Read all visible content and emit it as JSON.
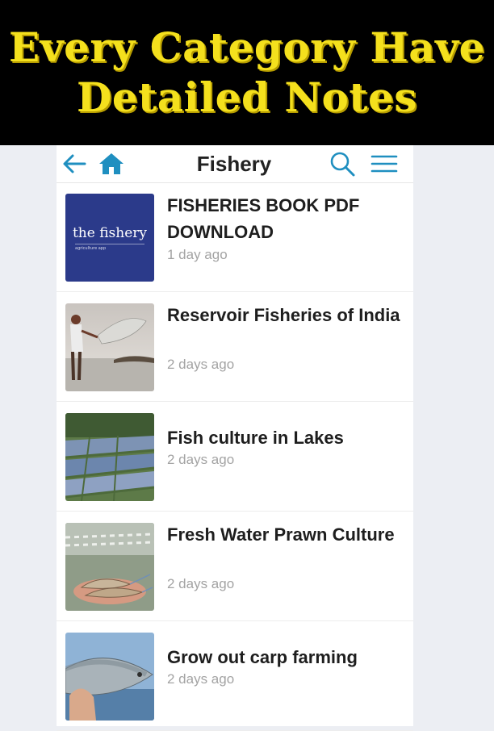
{
  "banner": {
    "line1": "Every Category Have",
    "line2": "Detailed Notes"
  },
  "appbar": {
    "title": "Fishery",
    "accent_color": "#1f8fc0"
  },
  "items": [
    {
      "title": "FISHERIES BOOK PDF DOWNLOAD",
      "time": "1 day ago",
      "thumb_title": "the fishery",
      "thumb_subtitle": "agriculture app"
    },
    {
      "title": "Reservoir Fisheries of India",
      "time": "2 days ago"
    },
    {
      "title": "Fish culture in Lakes",
      "time": "2 days ago"
    },
    {
      "title": "Fresh Water Prawn Culture",
      "time": "2 days ago"
    },
    {
      "title": "Grow out carp farming",
      "time": "2 days ago"
    }
  ]
}
